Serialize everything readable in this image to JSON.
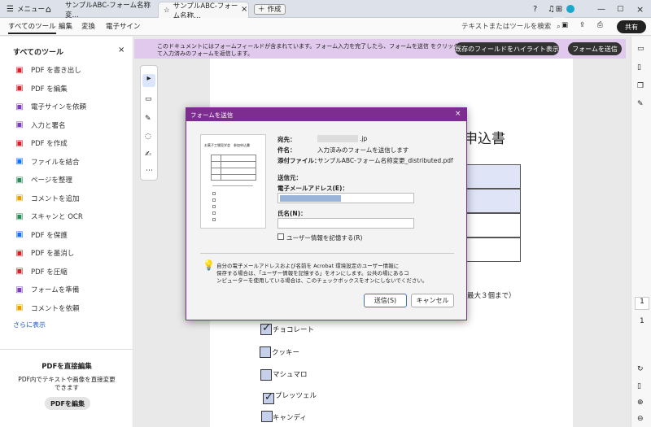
{
  "titlebar": {
    "menu_label": "メニュー",
    "tab1": "サンプルABC-フォーム名称変…",
    "tab2": "サンプルABC-フォーム名称…",
    "new_tab": "作成"
  },
  "menubar": {
    "items": [
      "すべてのツール",
      "編集",
      "変換",
      "電子サイン"
    ],
    "search": "テキストまたはツールを検索",
    "share": "共有"
  },
  "sidebar": {
    "title": "すべてのツール",
    "tools": [
      {
        "label": "PDF を書き出し",
        "color": "#d2232a"
      },
      {
        "label": "PDF を編集",
        "color": "#d2232a"
      },
      {
        "label": "電子サインを依頼",
        "color": "#7b3fb8"
      },
      {
        "label": "入力と署名",
        "color": "#7b3fb8"
      },
      {
        "label": "PDF を作成",
        "color": "#d2232a"
      },
      {
        "label": "ファイルを結合",
        "color": "#1a73e8"
      },
      {
        "label": "ページを整理",
        "color": "#2e8b57"
      },
      {
        "label": "コメントを追加",
        "color": "#e5a100"
      },
      {
        "label": "スキャンと OCR",
        "color": "#2e8b57"
      },
      {
        "label": "PDF を保護",
        "color": "#1a73e8"
      },
      {
        "label": "PDF を墨消し",
        "color": "#d2232a"
      },
      {
        "label": "PDF を圧縮",
        "color": "#d2232a"
      },
      {
        "label": "フォームを準備",
        "color": "#7b3fb8"
      },
      {
        "label": "コメントを依頼",
        "color": "#e5a100"
      }
    ],
    "more": "さらに表示",
    "promo_title": "PDFを直接編集",
    "promo_text1": "PDF内でテキストや画像を直接変更",
    "promo_text2": "できます",
    "promo_button": "PDFを編集"
  },
  "notice": {
    "text1": "このドキュメントにはフォームフィールドが含まれています。フォーム入力を完了したら、フォームを送信 をクリックし",
    "text2": "て入力済みのフォームを返信します。",
    "highlight_btn": "既存のフィールドをハイライト表示",
    "submit_btn": "フォームを送信"
  },
  "doc": {
    "heading": "申込書",
    "note": "最大３個まで）",
    "options": [
      "チョコレート",
      "クッキー",
      "マシュマロ",
      "プレッツェル",
      "キャンディ"
    ]
  },
  "thumb": {
    "title": "お菓子工場見学会　参加申込書"
  },
  "dialog": {
    "title": "フォームを送信",
    "to_label": "宛先：",
    "to_value": ".jp",
    "subject_label": "件名：",
    "subject_value": "入力済みのフォームを送信します",
    "attach_label": "添付ファイル：",
    "attach_value": "サンプルABC-フォーム名称変更_distributed.pdf",
    "from_label": "送信元：",
    "email_label": "電子メールアドレス(E)：",
    "name_label": "氏名(N)：",
    "remember_label": "ユーザー情報を記憶する(R)",
    "info1": "自分の電子メールアドレスおよび名前を Acrobat 環境設定のユーザー情報に",
    "info2": "保存する場合は、「ユーザー情報を記憶する」をオンにします。公共の場にあるコ",
    "info3": "ンピューターを使用している場合は、このチェックボックスをオンにしないでください。",
    "send": "送信(S)",
    "cancel": "キャンセル"
  },
  "pager": {
    "current": "1",
    "total": "1"
  }
}
